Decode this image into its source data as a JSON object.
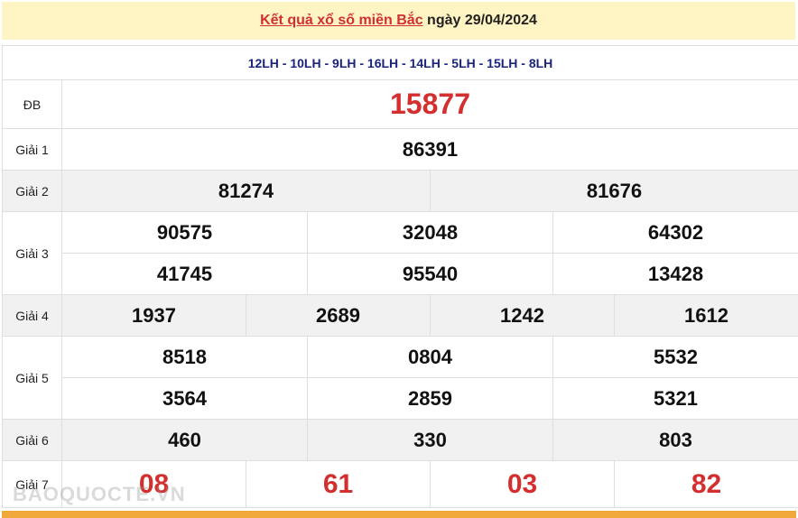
{
  "header": {
    "link_text": "Kết quả xổ số miền Bắc",
    "date_text": " ngày 29/04/2024"
  },
  "codes": "12LH - 10LH - 9LH - 16LH - 14LH - 5LH - 15LH - 8LH",
  "prizes": {
    "db": {
      "label": "ĐB",
      "numbers": [
        "15877"
      ]
    },
    "g1": {
      "label": "Giải 1",
      "numbers": [
        "86391"
      ]
    },
    "g2": {
      "label": "Giải 2",
      "numbers": [
        "81274",
        "81676"
      ]
    },
    "g3": {
      "label": "Giải 3",
      "numbers": [
        "90575",
        "32048",
        "64302",
        "41745",
        "95540",
        "13428"
      ]
    },
    "g4": {
      "label": "Giải 4",
      "numbers": [
        "1937",
        "2689",
        "1242",
        "1612"
      ]
    },
    "g5": {
      "label": "Giải 5",
      "numbers": [
        "8518",
        "0804",
        "5532",
        "3564",
        "2859",
        "5321"
      ]
    },
    "g6": {
      "label": "Giải 6",
      "numbers": [
        "460",
        "330",
        "803"
      ]
    },
    "g7": {
      "label": "Giải 7",
      "numbers": [
        "08",
        "61",
        "03",
        "82"
      ]
    }
  },
  "watermark": "BAOQUOCTE.VN",
  "colors": {
    "accent_red": "#d32f2f",
    "code_blue": "#1a237e",
    "header_bg": "#fff5c4",
    "bottom_bar": "#f0a83a"
  }
}
